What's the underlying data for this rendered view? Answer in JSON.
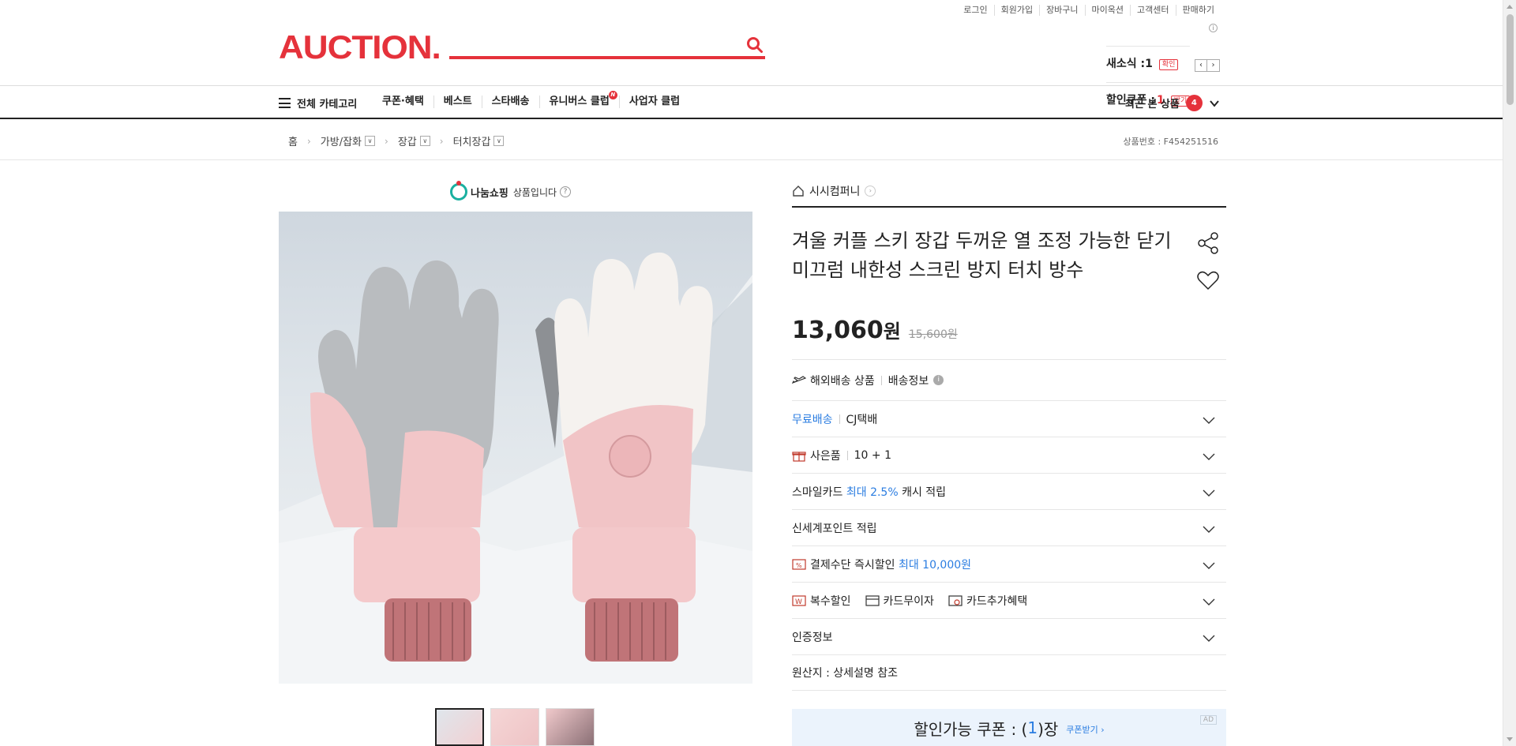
{
  "header": {
    "logo": "AUCTION.",
    "top_links": [
      "로그인",
      "회원가입",
      "장바구니",
      "마이옥션",
      "고객센터",
      "판매하기"
    ],
    "search_placeholder": "",
    "mini": {
      "new_label": "새소식 :",
      "new_count": "1",
      "new_action": "확인",
      "coupon_label": "할인쿠폰 :",
      "coupon_count": "1",
      "coupon_action": "받기"
    }
  },
  "nav": {
    "all_categories": "전체 카테고리",
    "menu": [
      "쿠폰·혜택",
      "베스트",
      "스타배송",
      "유니버스 클럽",
      "사업자 클럽"
    ],
    "universe_badge": "N",
    "recent_label": "최근 본 상품",
    "recent_count": "4"
  },
  "breadcrumb": {
    "home": "홈",
    "items": [
      "가방/잡화",
      "장갑",
      "터치장갑"
    ],
    "product_no": "상품번호 : F454251516"
  },
  "gallery": {
    "nanum_brand": "나눔쇼핑",
    "nanum_text": "상품입니다"
  },
  "product": {
    "seller": "시시컴퍼니",
    "title": "겨울 커플 스키 장갑 두꺼운 열 조정 가능한 닫기 미끄럼 내한성 스크린 방지 터치 방수",
    "price": "13,060",
    "price_unit": "원",
    "original_price": "15,600원",
    "rows": {
      "overseas": "해외배송 상품",
      "shipping_info": "배송정보",
      "free_shipping": "무료배송",
      "courier": "CJ택배",
      "gift_label": "사은품",
      "gift_value": "10 + 1",
      "smile_prefix": "스마일카드",
      "smile_highlight": "최대 2.5%",
      "smile_suffix": "캐시 적립",
      "shinsegae": "신세계포인트 적립",
      "pay_discount": "결제수단 즉시할인",
      "pay_highlight": "최대 10,000원",
      "multi_discount": "복수할인",
      "card_interest": "카드무이자",
      "card_benefit": "카드추가혜택",
      "certification": "인증정보",
      "origin": "원산지 : 상세설명 참조"
    },
    "coupon": {
      "prefix": "할인가능 쿠폰 : (",
      "count": "1",
      "suffix": ")장",
      "action": "쿠폰받기 ›",
      "ad": "AD"
    }
  },
  "colors": {
    "brand": "#e5323b",
    "accent_blue": "#2b7de1"
  }
}
